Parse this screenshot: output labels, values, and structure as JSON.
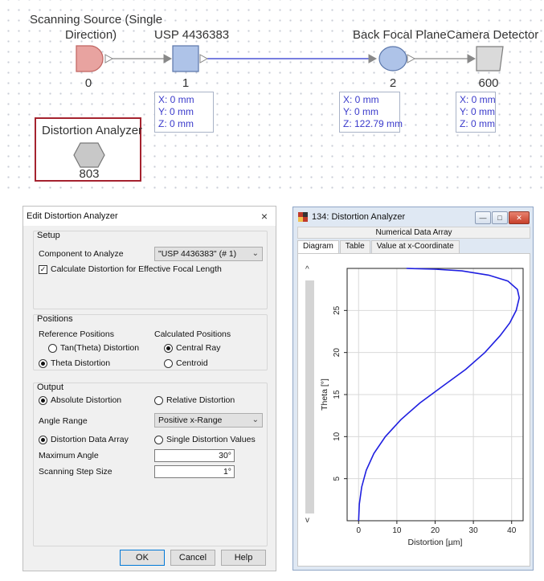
{
  "canvas": {
    "nodes": [
      {
        "id": "scanning-source",
        "label_line1": "Scanning Source (Single",
        "label_line2": "Direction)",
        "number": "0"
      },
      {
        "id": "usp",
        "label": "USP 4436383",
        "number": "1"
      },
      {
        "id": "back-focal-plane",
        "label": "Back Focal Plane",
        "number": "2"
      },
      {
        "id": "camera-detector",
        "label": "Camera Detector",
        "number": "600"
      },
      {
        "id": "distortion-analyzer",
        "label": "Distortion Analyzer",
        "number": "803"
      }
    ],
    "coords": [
      {
        "x": "X: 0 mm",
        "y": "Y: 0 mm",
        "z": "Z: 0 mm"
      },
      {
        "x": "X: 0 mm",
        "y": "Y: 0 mm",
        "z": "Z: 122.79 mm"
      },
      {
        "x": "X: 0 mm",
        "y": "Y: 0 mm",
        "z": "Z: 0 mm"
      }
    ],
    "colors": {
      "source": "#e8a3a0",
      "usp": "#aec3e8",
      "bfp": "#aec3e8",
      "detector": "#d4d4d4",
      "analyzer": "#c8c8c8",
      "beam": "#4b55d6",
      "frame": "#a5232f"
    }
  },
  "dialog": {
    "title": "Edit Distortion Analyzer",
    "close_glyph": "×",
    "setup": {
      "title": "Setup",
      "component_label": "Component to Analyze",
      "component_value": "\"USP 4436383\" (# 1)",
      "calc_checkbox_label": "Calculate Distortion for Effective Focal Length",
      "calc_checked": true
    },
    "positions": {
      "title": "Positions",
      "reference_label": "Reference Positions",
      "calculated_label": "Calculated Positions",
      "tan_theta": "Tan(Theta) Distortion",
      "theta": "Theta Distortion",
      "central_ray": "Central Ray",
      "centroid": "Centroid"
    },
    "output": {
      "title": "Output",
      "absolute": "Absolute Distortion",
      "relative": "Relative Distortion",
      "angle_range_label": "Angle Range",
      "angle_range_value": "Positive x-Range",
      "data_array": "Distortion Data Array",
      "single_values": "Single Distortion Values",
      "max_angle_label": "Maximum Angle",
      "max_angle_value": "30°",
      "step_label": "Scanning Step Size",
      "step_value": "1°"
    },
    "buttons": {
      "ok": "OK",
      "cancel": "Cancel",
      "help": "Help"
    }
  },
  "chart_window": {
    "title": "134: Distortion Analyzer",
    "subtitle": "Numerical Data Array",
    "tabs": [
      "Diagram",
      "Table",
      "Value at x-Coordinate"
    ],
    "active_tab": "Diagram",
    "scroll_up": "^",
    "scroll_down": "v"
  },
  "chart_data": {
    "type": "line",
    "xlabel": "Distortion [µm]",
    "ylabel": "Theta [°]",
    "xlim": [
      -3,
      43
    ],
    "ylim": [
      0,
      30
    ],
    "xticks": [
      0,
      10,
      20,
      30,
      40
    ],
    "yticks": [
      5,
      10,
      15,
      20,
      25
    ],
    "grid": true,
    "series": [
      {
        "color": "#1f1fe0",
        "x": [
          0,
          0.2,
          0.8,
          2,
          4,
          7,
          11,
          16,
          22,
          28,
          33,
          37,
          39.5,
          41.2,
          42,
          41.5,
          39,
          34,
          27,
          20,
          12.5
        ],
        "y": [
          0,
          2,
          4,
          6,
          8,
          10,
          12,
          14,
          16,
          18,
          20,
          22,
          23.5,
          25,
          26.5,
          27.5,
          28.5,
          29.2,
          29.7,
          29.9,
          30
        ]
      }
    ]
  }
}
